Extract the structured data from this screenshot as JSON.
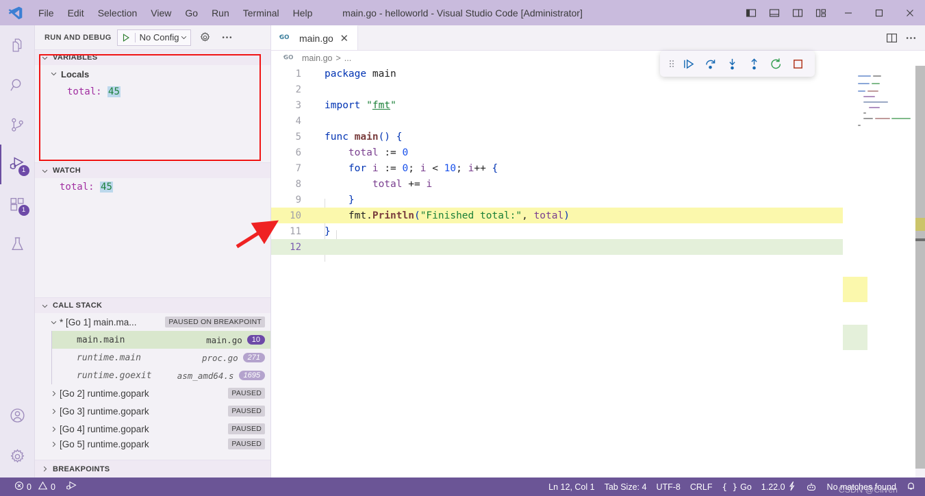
{
  "titlebar": {
    "logo_icon": "vscode-logo-icon",
    "menus": [
      "File",
      "Edit",
      "Selection",
      "View",
      "Go",
      "Run",
      "Terminal",
      "Help"
    ],
    "window_title": "main.go - helloworld - Visual Studio Code [Administrator]",
    "layout_buttons": [
      "toggle-primary-sidebar-icon",
      "toggle-panel-icon",
      "toggle-secondary-sidebar-icon",
      "customize-layout-icon"
    ],
    "window_controls": [
      "minimize-icon",
      "maximize-icon",
      "close-icon"
    ],
    "bg_color": "#c9bbdd"
  },
  "activitybar": {
    "items": [
      {
        "name": "explorer",
        "icon": "files-icon",
        "badge": "",
        "active": false
      },
      {
        "name": "search",
        "icon": "search-icon",
        "badge": "",
        "active": false
      },
      {
        "name": "source-control",
        "icon": "source-control-icon",
        "badge": "",
        "active": false
      },
      {
        "name": "run-and-debug",
        "icon": "run-and-debug-icon",
        "badge": "1",
        "active": true
      },
      {
        "name": "extensions",
        "icon": "extensions-icon",
        "badge": "1",
        "active": false
      },
      {
        "name": "testing",
        "icon": "beaker-icon",
        "badge": "",
        "active": false
      }
    ],
    "bottom_items": [
      {
        "name": "accounts",
        "icon": "account-icon"
      },
      {
        "name": "settings",
        "icon": "gear-icon"
      }
    ]
  },
  "sidebar": {
    "title": "RUN AND DEBUG",
    "config_label": "No Config",
    "config_play_icon": "start-debugging-icon",
    "gear_icon": "gear-icon",
    "more_icon": "more-actions-icon",
    "variables": {
      "title": "VARIABLES",
      "scope": "Locals",
      "entries": [
        {
          "name": "total:",
          "value": "45"
        }
      ],
      "highlight_color": "#f01414"
    },
    "watch": {
      "title": "WATCH",
      "entries": [
        {
          "name": "total:",
          "value": "45"
        }
      ]
    },
    "callstack": {
      "title": "CALL STACK",
      "threads": [
        {
          "label": "* [Go 1] main.ma...",
          "tag": "PAUSED ON BREAKPOINT",
          "expanded": true,
          "frames": [
            {
              "func": "main.main",
              "file": "main.go",
              "line": "10",
              "selected": true
            },
            {
              "func": "runtime.main",
              "file": "proc.go",
              "line": "271",
              "selected": false
            },
            {
              "func": "runtime.goexit",
              "file": "asm_amd64.s",
              "line": "1695",
              "selected": false
            }
          ]
        },
        {
          "label": "[Go 2] runtime.gopark",
          "tag": "PAUSED",
          "expanded": false,
          "frames": []
        },
        {
          "label": "[Go 3] runtime.gopark",
          "tag": "PAUSED",
          "expanded": false,
          "frames": []
        },
        {
          "label": "[Go 4] runtime.gopark",
          "tag": "PAUSED",
          "expanded": false,
          "frames": []
        },
        {
          "label": "[Go 5] runtime.gopark",
          "tag": "PAUSED",
          "expanded": false,
          "frames": []
        }
      ]
    },
    "breakpoints": {
      "title": "BREAKPOINTS"
    }
  },
  "editor": {
    "tab": {
      "label": "main.go",
      "icon": "go-file-icon",
      "close_icon": "close-icon"
    },
    "tab_actions": [
      "split-editor-icon",
      "more-actions-icon"
    ],
    "breadcrumb": {
      "icon": "go-file-icon",
      "file": "main.go",
      "separator": ">",
      "rest": "..."
    },
    "debug_toolbar": {
      "grip_icon": "drag-handle-icon",
      "buttons": [
        {
          "name": "continue",
          "icon": "continue-icon"
        },
        {
          "name": "step-over",
          "icon": "step-over-icon"
        },
        {
          "name": "step-into",
          "icon": "step-into-icon"
        },
        {
          "name": "step-out",
          "icon": "step-out-icon"
        },
        {
          "name": "restart",
          "icon": "restart-icon"
        },
        {
          "name": "stop",
          "icon": "stop-icon"
        }
      ]
    },
    "lines": [
      {
        "num": "1",
        "text": "package main"
      },
      {
        "num": "2",
        "text": ""
      },
      {
        "num": "3",
        "text": "import \"fmt\""
      },
      {
        "num": "4",
        "text": ""
      },
      {
        "num": "5",
        "text": "func main() {"
      },
      {
        "num": "6",
        "text": "    total := 0"
      },
      {
        "num": "7",
        "text": "    for i := 0; i < 10; i++ {"
      },
      {
        "num": "8",
        "text": "        total += i"
      },
      {
        "num": "9",
        "text": "    }"
      },
      {
        "num": "10",
        "text": "    fmt.Println(\"Finished total:\", total)"
      },
      {
        "num": "11",
        "text": "}"
      },
      {
        "num": "12",
        "text": ""
      }
    ],
    "breakpoint_line": "8",
    "execution_line": "10",
    "cursor_line": "12"
  },
  "statusbar": {
    "left": [
      {
        "name": "problems",
        "icon": "error-icon",
        "text": "0",
        "icon2": "warning-icon",
        "text2": "0"
      },
      {
        "name": "debug-run",
        "icon": "run-debug-icon",
        "text": ""
      }
    ],
    "right": [
      {
        "name": "cursor-position",
        "text": "Ln 12, Col 1"
      },
      {
        "name": "indentation",
        "text": "Tab Size: 4"
      },
      {
        "name": "encoding",
        "text": "UTF-8"
      },
      {
        "name": "eol",
        "text": "CRLF"
      },
      {
        "name": "language-mode",
        "text": "Go",
        "icon": "braces-icon"
      },
      {
        "name": "go-version",
        "text": "1.22.0",
        "icon": "go-lightning-icon"
      },
      {
        "name": "remote-host",
        "text": "",
        "icon": "remote-icon"
      },
      {
        "name": "search-result",
        "text": "No matches found"
      },
      {
        "name": "notifications",
        "text": "",
        "icon": "bell-icon"
      }
    ],
    "watermark": "CSDN @Cliven",
    "bg_color": "#6b5596"
  }
}
